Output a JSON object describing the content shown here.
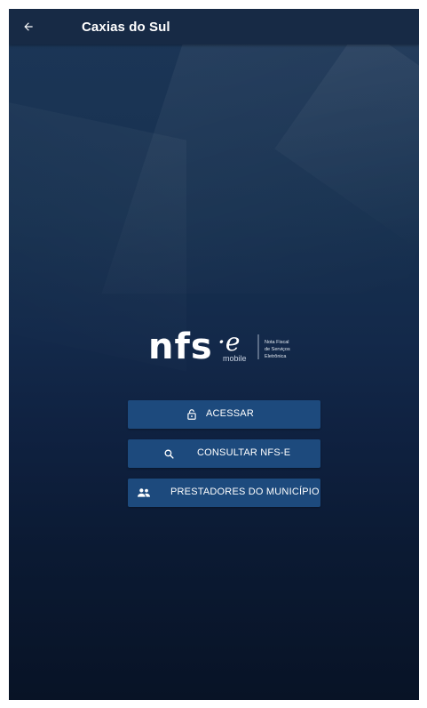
{
  "appbar": {
    "title": "Caxias do Sul",
    "back_icon": "arrow-left-icon"
  },
  "logo": {
    "wordmark": "nfs",
    "e_mark": "·e",
    "subtitle": "mobile",
    "tagline_1": "Nota Fiscal",
    "tagline_2": "de Serviços",
    "tagline_3": "Eletrônica"
  },
  "buttons": {
    "acessar": {
      "label": "ACESSAR",
      "icon": "lock-icon"
    },
    "consultar": {
      "label": "CONSULTAR NFS-E",
      "icon": "search-icon"
    },
    "prestadores": {
      "label": "PRESTADORES DO MUNICÍPIO",
      "icon": "people-icon"
    }
  },
  "colors": {
    "appbar": "#172a45",
    "button": "#1d4a7d",
    "background_top": "#1c3657",
    "background_bottom": "#081326"
  }
}
